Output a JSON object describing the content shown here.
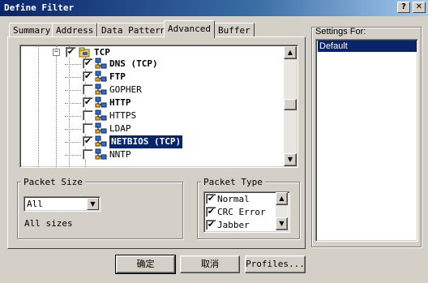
{
  "window": {
    "title": "Define Filter",
    "help_label": "?",
    "close_label": "✕"
  },
  "tabs": [
    {
      "label": "Summary",
      "active": false
    },
    {
      "label": "Address",
      "active": false
    },
    {
      "label": "Data Pattern",
      "active": false
    },
    {
      "label": "Advanced",
      "active": true
    },
    {
      "label": "Buffer",
      "active": false
    }
  ],
  "tree": {
    "parent": {
      "label": "TCP",
      "checked": true,
      "expander": "−"
    },
    "items": [
      {
        "label": "DNS (TCP)",
        "checked": true,
        "bold": true,
        "selected": false
      },
      {
        "label": "FTP",
        "checked": true,
        "bold": true,
        "selected": false
      },
      {
        "label": "GOPHER",
        "checked": false,
        "bold": false,
        "selected": false
      },
      {
        "label": "HTTP",
        "checked": true,
        "bold": true,
        "selected": false
      },
      {
        "label": "HTTPS",
        "checked": false,
        "bold": false,
        "selected": false
      },
      {
        "label": "LDAP",
        "checked": false,
        "bold": false,
        "selected": false
      },
      {
        "label": "NETBIOS (TCP)",
        "checked": true,
        "bold": true,
        "selected": true
      },
      {
        "label": "NNTP",
        "checked": false,
        "bold": false,
        "selected": false
      }
    ]
  },
  "packet_size": {
    "title": "Packet Size",
    "selected": "All",
    "description": "All sizes"
  },
  "packet_type": {
    "title": "Packet Type",
    "items": [
      {
        "label": "Normal",
        "checked": true
      },
      {
        "label": "CRC Error",
        "checked": true
      },
      {
        "label": "Jabber",
        "checked": true
      }
    ]
  },
  "settings": {
    "title": "Settings For:",
    "items": [
      "Default"
    ]
  },
  "buttons": {
    "ok": "确定",
    "cancel": "取消",
    "profiles": "Profiles..."
  },
  "colors": {
    "selection": "#0a246a",
    "face": "#d4d0c8"
  },
  "icons": {
    "check": "✔",
    "up_arrow": "▲",
    "down_arrow": "▼"
  }
}
